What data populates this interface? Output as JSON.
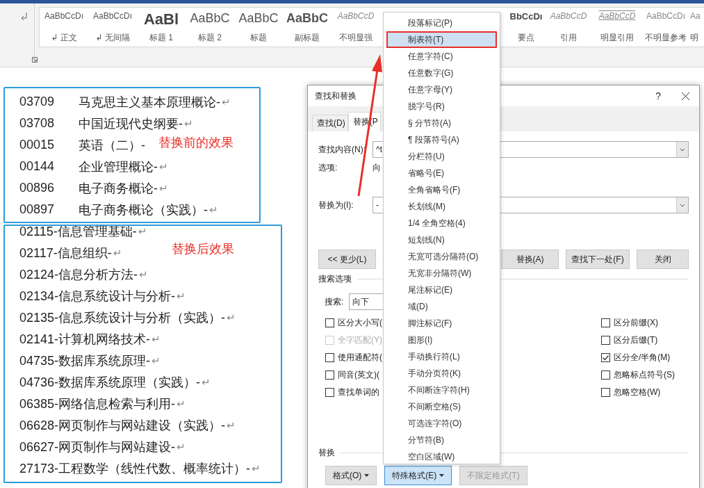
{
  "ribbon": {
    "styles_left": [
      {
        "preview": "AaBbCcDı",
        "name": "↲ 正文",
        "kind": "normal"
      },
      {
        "preview": "AaBbCcDı",
        "name": "↲ 无间隔",
        "kind": "normal"
      },
      {
        "preview": "AaBl",
        "name": "标题 1",
        "kind": "heading1"
      },
      {
        "preview": "AaBbC",
        "name": "标题 2",
        "kind": "heading2"
      },
      {
        "preview": "AaBbC",
        "name": "标题",
        "kind": "heading2"
      },
      {
        "preview": "AaBbC",
        "name": "副标题",
        "kind": "subtitle"
      },
      {
        "preview": "AaBbCcD",
        "name": "不明显强",
        "kind": "emphasis"
      }
    ],
    "styles_right": [
      {
        "preview": "BbCcDı",
        "name": "要点",
        "kind": "strong"
      },
      {
        "preview": "AaBbCcD",
        "name": "引用",
        "kind": "emphasis"
      },
      {
        "preview": "AaBbCcD",
        "name": "明显引用",
        "kind": "quote"
      },
      {
        "preview": "AaBbCcDı",
        "name": "不明显参考",
        "kind": "small"
      },
      {
        "preview": "Aa",
        "name": "明",
        "kind": "small"
      }
    ]
  },
  "document": {
    "lines": [
      {
        "kind": "tab",
        "code": "03709",
        "title": "马克思主义基本原理概论-",
        "mark": "↵"
      },
      {
        "kind": "tab",
        "code": "03708",
        "title": "中国近现代史纲要-",
        "mark": "↵"
      },
      {
        "kind": "tab",
        "code": "00015",
        "title": "英语（二）-"
      },
      {
        "kind": "tab",
        "code": "00144",
        "title": "企业管理概论-",
        "mark": "↵"
      },
      {
        "kind": "tab",
        "code": "00896",
        "title": "电子商务概论-",
        "mark": "↵"
      },
      {
        "kind": "tab",
        "code": "00897",
        "title": "电子商务概论（实践）-",
        "mark": "↵"
      },
      {
        "kind": "dash",
        "title": "02115-信息管理基础-",
        "mark": "↵"
      },
      {
        "kind": "dash",
        "title": "02117-信息组织-",
        "mark": "↵"
      },
      {
        "kind": "dash",
        "title": "02124-信息分析方法-",
        "mark": "↵"
      },
      {
        "kind": "dash",
        "title": "02134-信息系统设计与分析-",
        "mark": "↵"
      },
      {
        "kind": "dash",
        "title": "02135-信息系统设计与分析（实践）-",
        "mark": "↵"
      },
      {
        "kind": "dash",
        "title": "02141-计算机网络技术-",
        "mark": "↵"
      },
      {
        "kind": "dash",
        "title": "04735-数据库系统原理-",
        "mark": "↵"
      },
      {
        "kind": "dash",
        "title": "04736-数据库系统原理（实践）-",
        "mark": "↵"
      },
      {
        "kind": "dash",
        "title": "06385-网络信息检索与利用-",
        "mark": "↵"
      },
      {
        "kind": "dash",
        "title": "06628-网页制作与网站建设（实践）-",
        "mark": "↵"
      },
      {
        "kind": "dash",
        "title": "06627-网页制作与网站建设-",
        "mark": "↵"
      },
      {
        "kind": "dash",
        "title": "27173-工程数学（线性代数、概率统计）-",
        "mark": "↵"
      }
    ]
  },
  "annotations": [
    "替换前的效果",
    "替换后效果"
  ],
  "dialog": {
    "title": "查找和替换",
    "help": "?",
    "tabs": [
      {
        "label": "查找(D)",
        "selected": false
      },
      {
        "label": "替换(P",
        "selected": true
      }
    ],
    "find_label": "查找内容(N):",
    "find_value": "^t",
    "options_label": "选项:",
    "options_value": "向",
    "replace_label": "替换为(I):",
    "replace_value": "-",
    "less_button": "<< 更少(L)",
    "buttons": [
      "替换(A)",
      "查找下一处(F)",
      "关闭"
    ],
    "search_options_title": "搜索选项",
    "search_label": "搜索:",
    "search_value": "向下",
    "options_left": [
      {
        "label": "区分大小写(",
        "checked": false,
        "disabled": false
      },
      {
        "label": "全字匹配(Y)",
        "checked": false,
        "disabled": true
      },
      {
        "label": "使用通配符(",
        "checked": false,
        "disabled": false
      },
      {
        "label": "同音(英文)(",
        "checked": false,
        "disabled": false
      },
      {
        "label": "查找单词的",
        "checked": false,
        "disabled": false
      }
    ],
    "options_right": [
      {
        "label": "区分前缀(X)",
        "checked": false,
        "disabled": false
      },
      {
        "label": "区分后缀(T)",
        "checked": false,
        "disabled": false
      },
      {
        "label": "区分全/半角(M)",
        "checked": true,
        "disabled": false
      },
      {
        "label": "忽略标点符号(S)",
        "checked": false,
        "disabled": false
      },
      {
        "label": "忽略空格(W)",
        "checked": false,
        "disabled": false
      }
    ],
    "replace_title": "替换",
    "bottom_buttons": [
      {
        "label": "格式(O)",
        "caret": true,
        "pressed": false,
        "disabled": false
      },
      {
        "label": "特殊格式(E)",
        "caret": true,
        "pressed": true,
        "disabled": false
      },
      {
        "label": "不限定格式(T)",
        "caret": false,
        "pressed": false,
        "disabled": true
      }
    ]
  },
  "special_menu": {
    "items": [
      {
        "label": "段落标记(P)",
        "selected": false
      },
      {
        "label": "制表符(T)",
        "selected": true
      },
      {
        "label": "任意字符(C)",
        "selected": false
      },
      {
        "label": "任意数字(G)",
        "selected": false
      },
      {
        "label": "任意字母(Y)",
        "selected": false
      },
      {
        "label": "脱字号(R)",
        "selected": false
      },
      {
        "label": "§ 分节符(A)",
        "selected": false
      },
      {
        "label": "¶ 段落符号(A)",
        "selected": false
      },
      {
        "label": "分栏符(U)",
        "selected": false
      },
      {
        "label": "省略号(E)",
        "selected": false
      },
      {
        "label": "全角省略号(F)",
        "selected": false
      },
      {
        "label": "长划线(M)",
        "selected": false
      },
      {
        "label": "1/4 全角空格(4)",
        "selected": false
      },
      {
        "label": "短划线(N)",
        "selected": false
      },
      {
        "label": "无宽可选分隔符(O)",
        "selected": false
      },
      {
        "label": "无宽非分隔符(W)",
        "selected": false
      },
      {
        "label": "尾注标记(E)",
        "selected": false
      },
      {
        "label": "域(D)",
        "selected": false
      },
      {
        "label": "脚注标记(F)",
        "selected": false
      },
      {
        "label": "图形(I)",
        "selected": false
      },
      {
        "label": "手动换行符(L)",
        "selected": false
      },
      {
        "label": "手动分页符(K)",
        "selected": false
      },
      {
        "label": "不间断连字符(H)",
        "selected": false
      },
      {
        "label": "不间断空格(S)",
        "selected": false
      },
      {
        "label": "可选连字符(O)",
        "selected": false
      },
      {
        "label": "分节符(B)",
        "selected": false
      },
      {
        "label": "空白区域(W)",
        "selected": false
      }
    ]
  }
}
